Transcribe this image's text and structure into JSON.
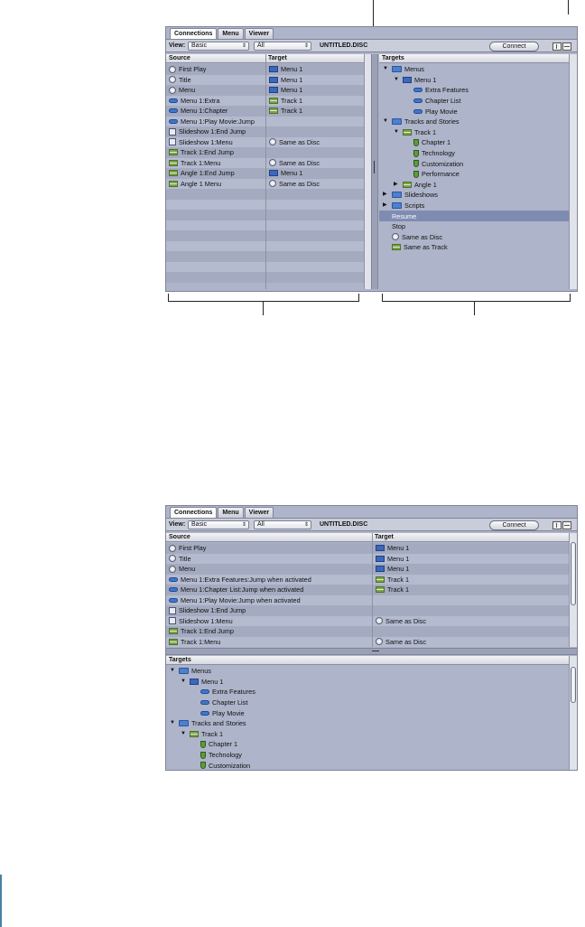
{
  "tabs": [
    "Connections",
    "Menu",
    "Viewer"
  ],
  "toolbar": {
    "view_label": "View:",
    "view_value": "Basic",
    "filter_value": "All",
    "disc_name": "UNTITLED.DISC",
    "connect_label": "Connect"
  },
  "top_panel": {
    "source_header": "Source",
    "target_header": "Target",
    "rows": [
      {
        "source": "First Play",
        "source_icon": "circle-icon",
        "target": "Menu 1",
        "target_icon": "menu-icon"
      },
      {
        "source": "Title",
        "source_icon": "circle-icon",
        "target": "Menu 1",
        "target_icon": "menu-icon"
      },
      {
        "source": "Menu",
        "source_icon": "circle-icon",
        "target": "Menu 1",
        "target_icon": "menu-icon"
      },
      {
        "source": "Menu 1:Extra",
        "source_icon": "button-icon",
        "target": "Track 1",
        "target_icon": "track-icon"
      },
      {
        "source": "Menu 1:Chapter",
        "source_icon": "button-icon",
        "target": "Track 1",
        "target_icon": "track-icon"
      },
      {
        "source": "Menu 1:Play Movie:Jump",
        "source_icon": "button-icon",
        "target": "",
        "target_icon": ""
      },
      {
        "source": "Slideshow 1:End Jump",
        "source_icon": "slideshow-icon",
        "target": "",
        "target_icon": ""
      },
      {
        "source": "Slideshow 1:Menu",
        "source_icon": "slideshow-icon",
        "target": "Same as Disc",
        "target_icon": "circle-icon"
      },
      {
        "source": "Track 1:End Jump",
        "source_icon": "track-icon",
        "target": "",
        "target_icon": ""
      },
      {
        "source": "Track 1:Menu",
        "source_icon": "track-icon",
        "target": "Same as Disc",
        "target_icon": "circle-icon"
      },
      {
        "source": "Angle 1:End Jump",
        "source_icon": "track-icon",
        "target": "Menu 1",
        "target_icon": "menu-icon"
      },
      {
        "source": "Angle 1 Menu",
        "source_icon": "track-icon",
        "target": "Same as Disc",
        "target_icon": "circle-icon"
      }
    ],
    "empty_rows": 9,
    "targets_header": "Targets",
    "targets": [
      {
        "label": "Menus",
        "icon": "folder-icon",
        "indent": 0,
        "tri": "down"
      },
      {
        "label": "Menu 1",
        "icon": "menu-icon",
        "indent": 1,
        "tri": "down"
      },
      {
        "label": "Extra Features",
        "icon": "button-icon",
        "indent": 2,
        "tri": ""
      },
      {
        "label": "Chapter List",
        "icon": "button-icon",
        "indent": 2,
        "tri": ""
      },
      {
        "label": "Play Movie",
        "icon": "button-icon",
        "indent": 2,
        "tri": ""
      },
      {
        "label": "Tracks and Stories",
        "icon": "folder-icon",
        "indent": 0,
        "tri": "down"
      },
      {
        "label": "Track 1",
        "icon": "track-icon",
        "indent": 1,
        "tri": "down"
      },
      {
        "label": "Chapter 1",
        "icon": "chapter-icon",
        "indent": 2,
        "tri": ""
      },
      {
        "label": "Technology",
        "icon": "chapter-icon",
        "indent": 2,
        "tri": ""
      },
      {
        "label": "Customization",
        "icon": "chapter-icon",
        "indent": 2,
        "tri": ""
      },
      {
        "label": "Performance",
        "icon": "chapter-icon",
        "indent": 2,
        "tri": ""
      },
      {
        "label": "Angle 1",
        "icon": "track-icon",
        "indent": 1,
        "tri": "right"
      },
      {
        "label": "Slideshows",
        "icon": "folder-icon",
        "indent": 0,
        "tri": "right"
      },
      {
        "label": "Scripts",
        "icon": "folder-icon",
        "indent": 0,
        "tri": "right"
      },
      {
        "label": "Resume",
        "icon": "",
        "indent": 0,
        "tri": "",
        "selected": true
      },
      {
        "label": "Stop",
        "icon": "",
        "indent": 0,
        "tri": ""
      },
      {
        "label": "Same as Disc",
        "icon": "circle-icon",
        "indent": 0,
        "tri": ""
      },
      {
        "label": "Same as Track",
        "icon": "track-icon",
        "indent": 0,
        "tri": ""
      }
    ]
  },
  "bottom_panel": {
    "source_header": "Source",
    "target_header": "Target",
    "rows": [
      {
        "source": "First Play",
        "source_icon": "circle-icon",
        "target": "Menu 1",
        "target_icon": "menu-icon"
      },
      {
        "source": "Title",
        "source_icon": "circle-icon",
        "target": "Menu 1",
        "target_icon": "menu-icon"
      },
      {
        "source": "Menu",
        "source_icon": "circle-icon",
        "target": "Menu 1",
        "target_icon": "menu-icon"
      },
      {
        "source": "Menu 1:Extra Features:Jump when activated",
        "source_icon": "button-icon",
        "target": "Track 1",
        "target_icon": "track-icon"
      },
      {
        "source": "Menu 1:Chapter List:Jump when activated",
        "source_icon": "button-icon",
        "target": "Track 1",
        "target_icon": "track-icon"
      },
      {
        "source": "Menu 1:Play Movie:Jump when activated",
        "source_icon": "button-icon",
        "target": "",
        "target_icon": ""
      },
      {
        "source": "Slideshow 1:End Jump",
        "source_icon": "slideshow-icon",
        "target": "",
        "target_icon": ""
      },
      {
        "source": "Slideshow 1:Menu",
        "source_icon": "slideshow-icon",
        "target": "Same as Disc",
        "target_icon": "circle-icon"
      },
      {
        "source": "Track 1:End Jump",
        "source_icon": "track-icon",
        "target": "",
        "target_icon": ""
      },
      {
        "source": "Track 1:Menu",
        "source_icon": "track-icon",
        "target": "Same as Disc",
        "target_icon": "circle-icon"
      }
    ],
    "targets_header": "Targets",
    "targets": [
      {
        "label": "Menus",
        "icon": "folder-icon",
        "indent": 0,
        "tri": "down"
      },
      {
        "label": "Menu 1",
        "icon": "menu-icon",
        "indent": 1,
        "tri": "down"
      },
      {
        "label": "Extra Features",
        "icon": "button-icon",
        "indent": 2,
        "tri": ""
      },
      {
        "label": "Chapter List",
        "icon": "button-icon",
        "indent": 2,
        "tri": ""
      },
      {
        "label": "Play Movie",
        "icon": "button-icon",
        "indent": 2,
        "tri": ""
      },
      {
        "label": "Tracks and Stories",
        "icon": "folder-icon",
        "indent": 0,
        "tri": "down"
      },
      {
        "label": "Track 1",
        "icon": "track-icon",
        "indent": 1,
        "tri": "down"
      },
      {
        "label": "Chapter 1",
        "icon": "chapter-icon",
        "indent": 2,
        "tri": ""
      },
      {
        "label": "Technology",
        "icon": "chapter-icon",
        "indent": 2,
        "tri": ""
      },
      {
        "label": "Customization",
        "icon": "chapter-icon",
        "indent": 2,
        "tri": ""
      }
    ]
  },
  "colors": {
    "panel_bg": "#aeb4c9",
    "selection": "#7f8cb2",
    "row_dark": "#a4aabf",
    "row_light": "#b5bbcf"
  }
}
